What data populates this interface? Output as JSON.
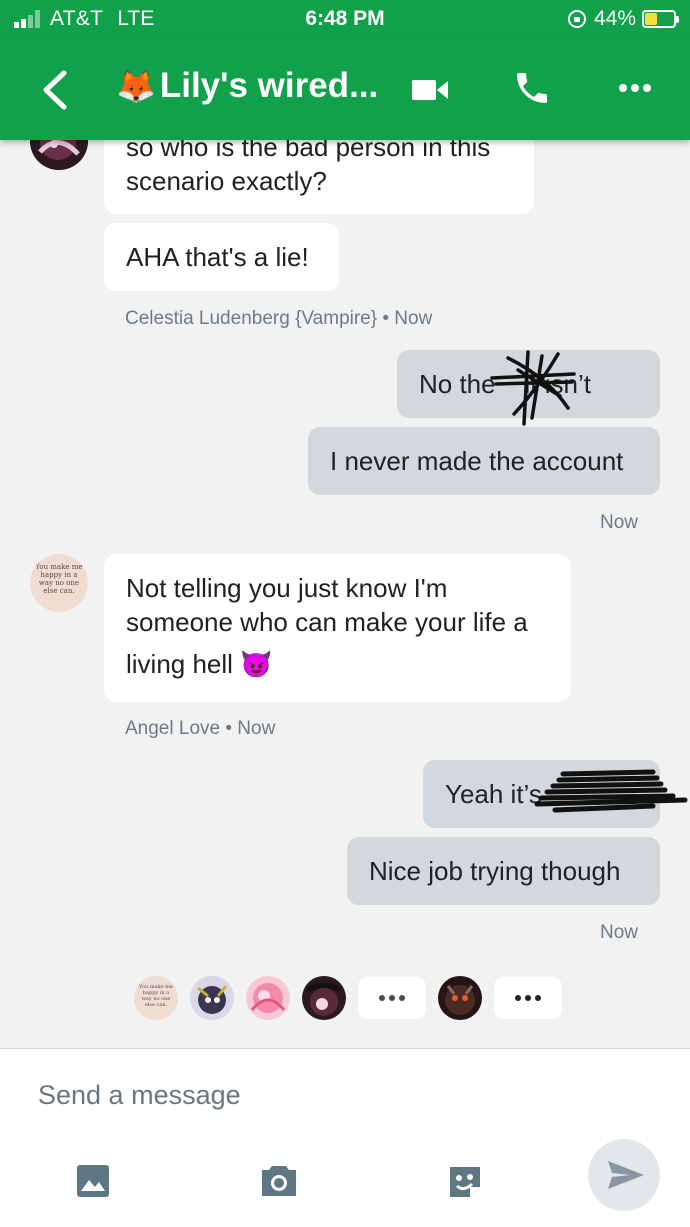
{
  "status_bar": {
    "carrier": "AT&T",
    "network": "LTE",
    "time": "6:48 PM",
    "battery_percent": "44%",
    "battery_level": 0.44
  },
  "header": {
    "title_emoji": "🦊",
    "title": "Lily's wired...",
    "icons": [
      "back-arrow-icon",
      "video-camera-icon",
      "phone-icon",
      "more-horizontal-icon"
    ]
  },
  "messages": [
    {
      "direction": "in",
      "text_lines": [
        "so who is the bad person in this",
        "scenario exactly?"
      ]
    },
    {
      "direction": "in",
      "text": "AHA that's a lie!"
    },
    {
      "type": "meta",
      "text": "Celestia Ludenberg {Vampire} • Now"
    },
    {
      "direction": "out",
      "text": "No the    it isn’t"
    },
    {
      "direction": "out",
      "text": "I never made the account"
    },
    {
      "type": "meta",
      "text": "Now"
    },
    {
      "direction": "in",
      "avatar_text": "You make me happy in a way no one else can.",
      "text_lines": [
        "Not telling you just know I'm",
        "someone who can make your life a",
        "living hell"
      ],
      "emoji": "😈"
    },
    {
      "type": "meta",
      "text": "Angel Love • Now"
    },
    {
      "direction": "out",
      "text": "Yeah it’s"
    },
    {
      "direction": "out",
      "text": "Nice job trying though"
    },
    {
      "type": "meta",
      "text": "Now"
    }
  ],
  "read_receipts": {
    "avatar_text": "You make me happy in a way no one else can."
  },
  "composer": {
    "placeholder": "Send a message",
    "icons": [
      "image-icon",
      "camera-icon",
      "sticker-icon",
      "send-icon"
    ]
  },
  "colors": {
    "brand_green": "#10a14a",
    "incoming_bubble": "#ffffff",
    "outgoing_bubble": "#d3d8dc",
    "background": "#f2f2f2",
    "meta_text": "#6d7b87"
  }
}
